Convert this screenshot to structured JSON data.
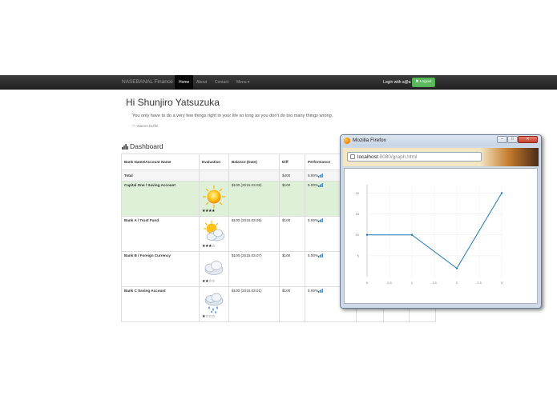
{
  "navbar": {
    "brand": "NASEBANAL Finance",
    "items": [
      {
        "label": "Home",
        "active": true
      },
      {
        "label": "About",
        "active": false
      },
      {
        "label": "Contact",
        "active": false
      },
      {
        "label": "Menu ▾",
        "active": false
      }
    ],
    "login_text": "Login with a@a",
    "logout_label": "Logout"
  },
  "greeting": "Hi Shunjiro Yatsuzuka",
  "quote": {
    "text": "You only have to do a very few things right in your life so long as you don't do too many things wrong.",
    "author": "— Warren Buffet"
  },
  "dashboard": {
    "title": "Dashboard",
    "columns": [
      "Bank Name/Account Name",
      "Evaluation",
      "Balance (Date)",
      "Diff",
      "Performance"
    ],
    "total": {
      "label": "Total",
      "diff": "$400",
      "performance": "5.00%"
    },
    "rows": [
      {
        "name": "Capital One / Saving Account",
        "weather": "sunny-icon",
        "stars": "★★★★",
        "balance": "$100 (2015.03.08)",
        "diff": "$100",
        "performance": "5.00%"
      },
      {
        "name": "Bank A / Trust Fund",
        "weather": "partly-cloudy-icon",
        "stars": "★★★☆",
        "balance": "$100 (2015.03.05)",
        "diff": "$100",
        "performance": "5.00%"
      },
      {
        "name": "Bank B / Foreign Currency",
        "weather": "cloudy-icon",
        "stars": "★★☆☆",
        "balance": "$100 (2015.03.07)",
        "diff": "$100",
        "performance": "5.00%"
      },
      {
        "name": "Bank C Saving Account",
        "weather": "rain-icon",
        "stars": "★☆☆☆",
        "balance": "$100 (2015.03.01)",
        "diff": "$100",
        "performance": "5.00%"
      }
    ]
  },
  "popup": {
    "window_title": "Mozilla Firefox",
    "url_host": "localhost",
    "url_rest": ":8080/graph.html",
    "buttons": {
      "minimize": "–",
      "maximize": "□",
      "close": "✕"
    }
  },
  "chart_data": {
    "type": "line",
    "x": [
      0,
      1,
      2,
      3
    ],
    "y": [
      10,
      10,
      2,
      20
    ],
    "xticks": [
      "0",
      "0.5",
      "1",
      "1.5",
      "2",
      "2.5",
      "3"
    ],
    "yticks": [
      "20",
      "15",
      "10",
      "5"
    ],
    "xlim": [
      0,
      3
    ],
    "ylim": [
      0,
      22
    ],
    "color": "#1f77b4",
    "grid": true
  }
}
